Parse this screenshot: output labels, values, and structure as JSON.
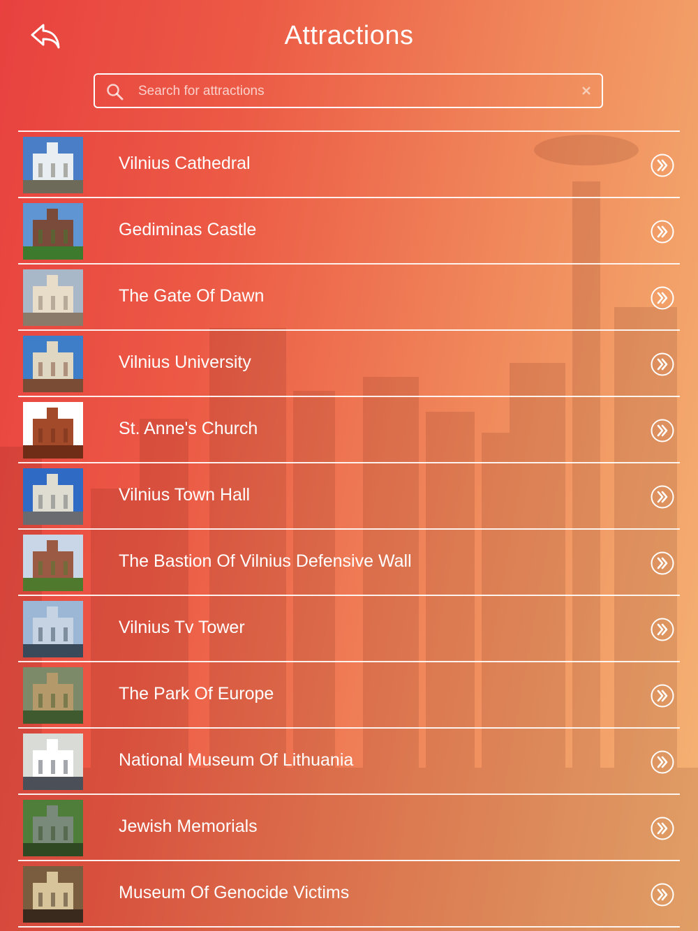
{
  "header": {
    "title": "Attractions"
  },
  "search": {
    "placeholder": "Search for attractions",
    "value": ""
  },
  "attractions": [
    {
      "label": "Vilnius Cathedral",
      "thumb": [
        "#4a7fc7",
        "#e9eef2",
        "#6d6a5a"
      ]
    },
    {
      "label": "Gediminas Castle",
      "thumb": [
        "#5f95d3",
        "#7a4b3a",
        "#3d7a2e"
      ]
    },
    {
      "label": "The Gate Of Dawn",
      "thumb": [
        "#a9b8c9",
        "#e7ddc8",
        "#8a7a6a"
      ]
    },
    {
      "label": "Vilnius University",
      "thumb": [
        "#3e7ec9",
        "#e0d7c3",
        "#7a4c36"
      ]
    },
    {
      "label": "St. Anne's Church",
      "thumb": [
        "#ffffff",
        "#a34a2a",
        "#6f2d18"
      ]
    },
    {
      "label": "Vilnius Town Hall",
      "thumb": [
        "#2f6bc4",
        "#dfdcd2",
        "#6a6b70"
      ]
    },
    {
      "label": "The Bastion Of Vilnius Defensive Wall",
      "thumb": [
        "#c9d6e8",
        "#9a5a44",
        "#4f7a2e"
      ]
    },
    {
      "label": "Vilnius Tv Tower",
      "thumb": [
        "#9cb6d6",
        "#c5d3e2",
        "#3a4a5a"
      ]
    },
    {
      "label": "The Park Of Europe",
      "thumb": [
        "#7d8a6a",
        "#b49a6a",
        "#3f5a2e"
      ]
    },
    {
      "label": "National Museum Of Lithuania",
      "thumb": [
        "#d9dbd6",
        "#ffffff",
        "#4a4f58"
      ]
    },
    {
      "label": "Jewish Memorials",
      "thumb": [
        "#4f7e3a",
        "#7a8a7a",
        "#2f4a22"
      ]
    },
    {
      "label": "Museum Of Genocide Victims",
      "thumb": [
        "#7a5d3e",
        "#d8c49a",
        "#3a2a1e"
      ]
    }
  ],
  "icons": {
    "back": "reply-arrow-icon",
    "search": "magnifier-icon",
    "clear": "close-icon",
    "row_action": "double-chevron-right-icon"
  }
}
